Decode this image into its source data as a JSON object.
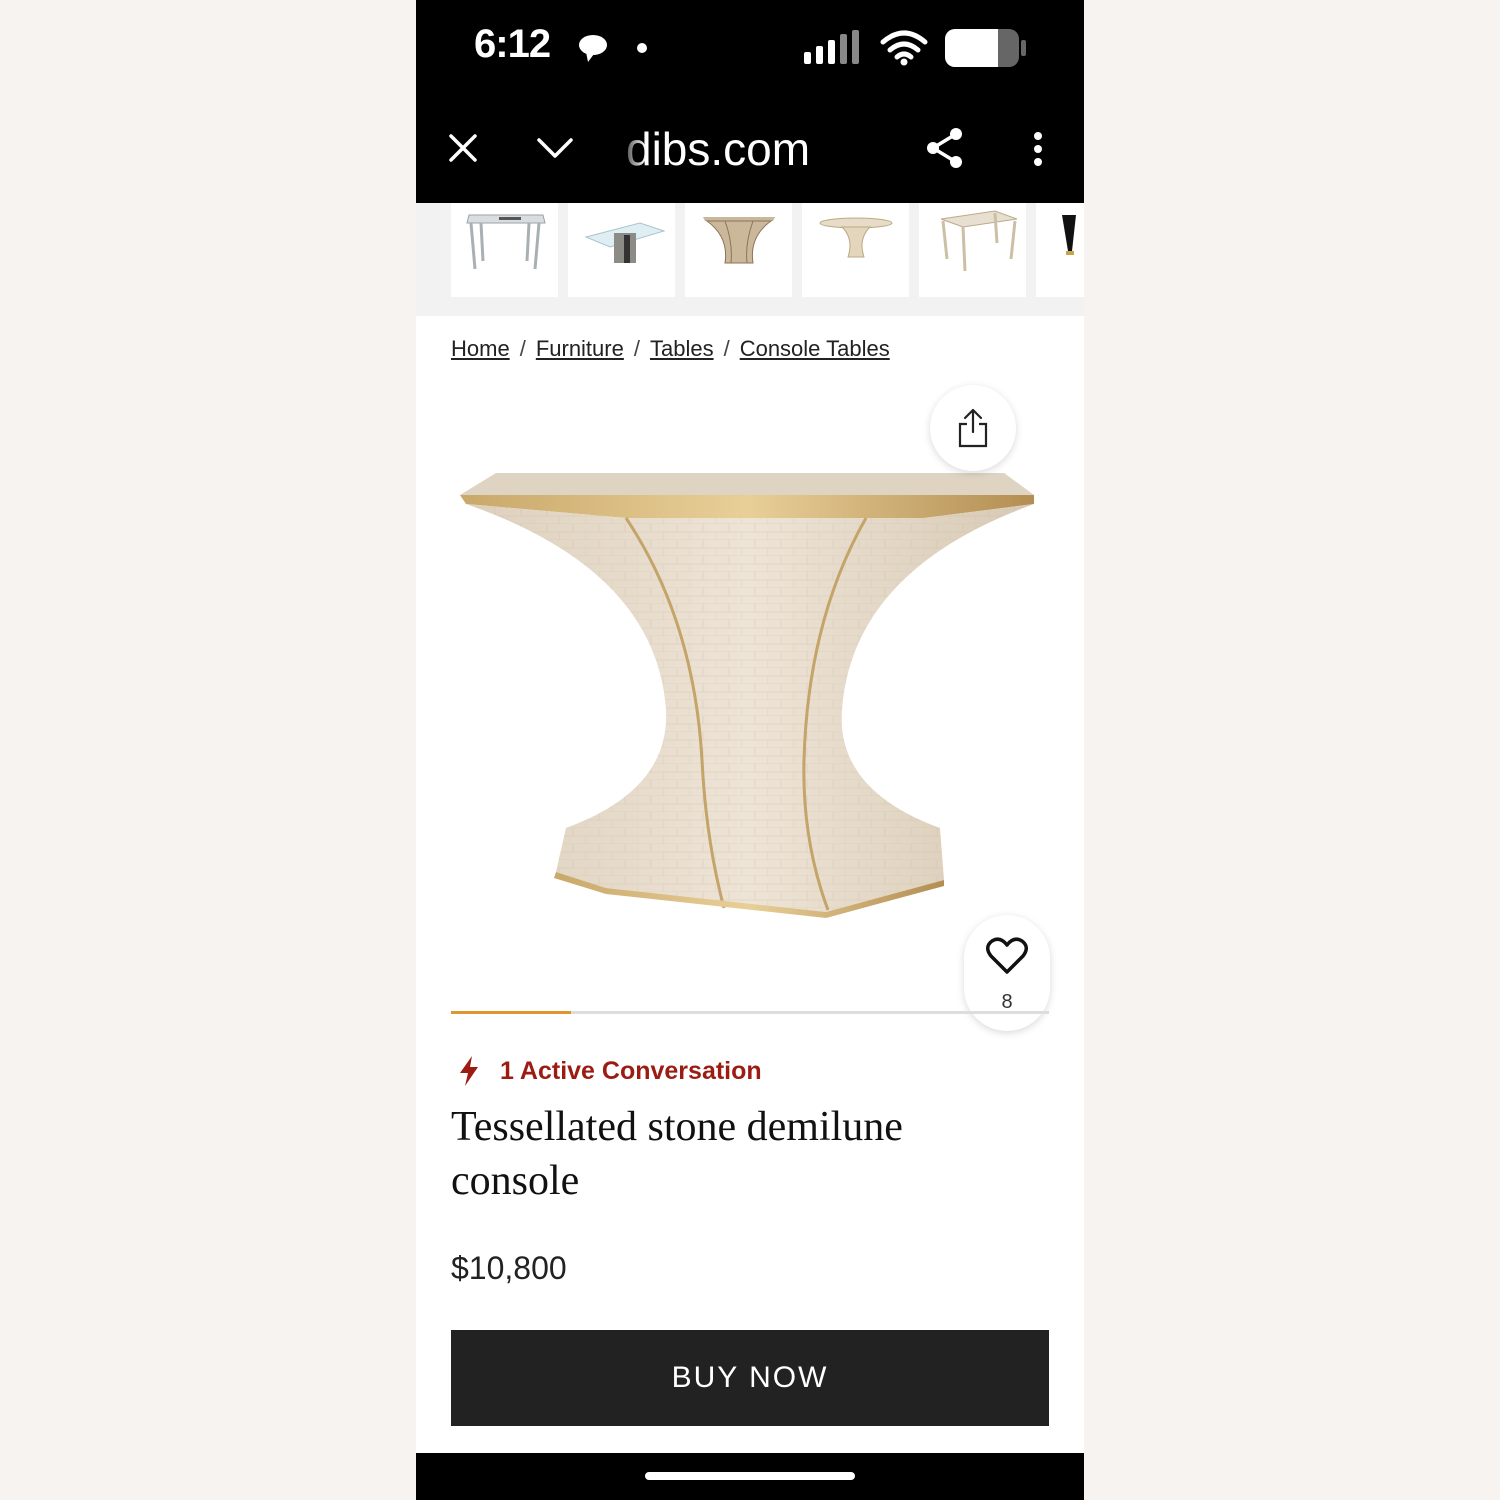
{
  "status_bar": {
    "time": "6:12"
  },
  "browser": {
    "url": "dibs.com"
  },
  "breadcrumb": {
    "items": [
      "Home",
      "Furniture",
      "Tables",
      "Console Tables"
    ],
    "separator": "/"
  },
  "product": {
    "favorites_count": "8",
    "gallery_progress": 0.2,
    "active_conversation": "1 Active Conversation",
    "title": "Tessellated stone demilune console",
    "price": "$10,800",
    "buy_label": "BUY NOW"
  },
  "colors": {
    "accent_progress": "#e0962e",
    "conversation_red": "#9c1c14",
    "buy_button": "#222222"
  },
  "icons": {
    "close": "close-icon",
    "chevron": "chevron-down-icon",
    "share": "share-icon",
    "menu": "more-vertical-icon",
    "upload": "upload-share-icon",
    "heart": "heart-icon",
    "lightning": "lightning-icon"
  }
}
